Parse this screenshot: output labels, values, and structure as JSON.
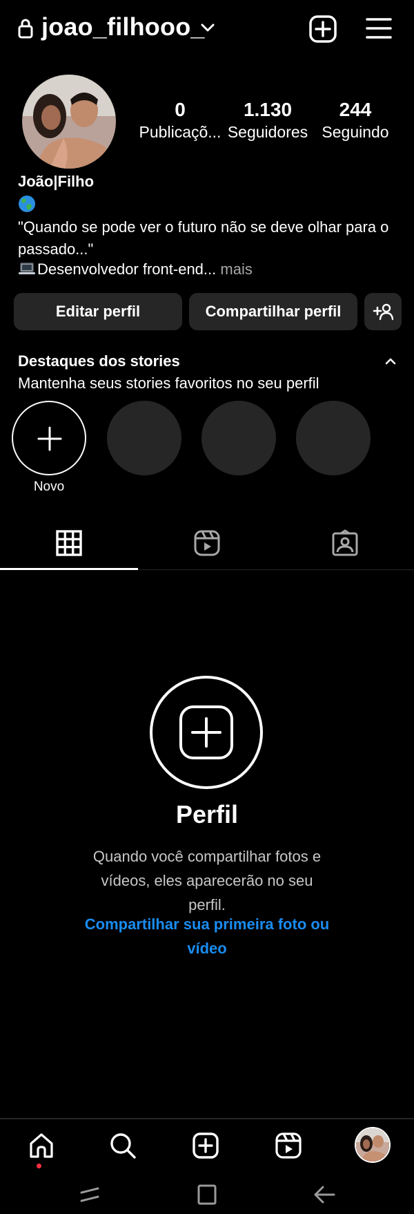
{
  "header": {
    "username": "joao_filhooo_",
    "icons": [
      "lock-icon",
      "chevron-down-icon",
      "add-square-icon",
      "menu-icon"
    ]
  },
  "profile": {
    "stats": [
      {
        "value": "0",
        "label": "Publicaçõ..."
      },
      {
        "value": "1.130",
        "label": "Seguidores"
      },
      {
        "value": "244",
        "label": "Seguindo"
      }
    ],
    "name": "João|Filho",
    "bio_quote": "\"Quando se pode ver o futuro não se deve olhar para o passado...\"",
    "bio_role": "Desenvolvedor front-end...",
    "bio_more": " mais"
  },
  "actions": {
    "edit_label": "Editar perfil",
    "share_label": "Compartilhar perfil"
  },
  "highlights": {
    "title": "Destaques dos stories",
    "subtitle": "Mantenha seus stories favoritos no seu perfil",
    "new_label": "Novo"
  },
  "tabs": [
    "grid-icon",
    "reels-icon",
    "tagged-icon"
  ],
  "empty_state": {
    "title": "Perfil",
    "description": "Quando você compartilhar fotos e vídeos, eles aparecerão no seu perfil.",
    "link": "Compartilhar sua primeira foto ou vídeo"
  },
  "bottom_nav": [
    "home-icon",
    "search-icon",
    "create-icon",
    "reels-icon",
    "profile-avatar"
  ],
  "colors": {
    "background": "#000000",
    "button": "#262626",
    "link": "#1a8cef",
    "notification_dot": "#ff3040"
  }
}
